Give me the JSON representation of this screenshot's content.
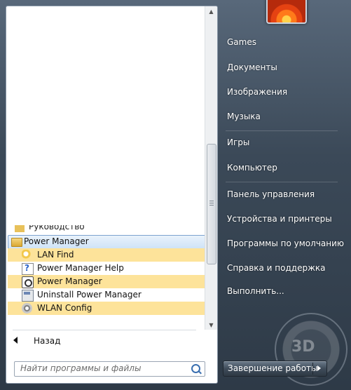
{
  "left": {
    "partial_item": "Руководство",
    "folder": "Power Manager",
    "entries": [
      {
        "label": "LAN Find",
        "icon": "lan-find-icon"
      },
      {
        "label": "Power Manager Help",
        "icon": "help-icon"
      },
      {
        "label": "Power Manager",
        "icon": "power-manager-icon"
      },
      {
        "label": "Uninstall Power Manager",
        "icon": "uninstall-icon"
      },
      {
        "label": "WLAN Config",
        "icon": "wlan-config-icon"
      }
    ],
    "back_label": "Назад",
    "search_placeholder": "Найти программы и файлы"
  },
  "right": {
    "items": [
      "Games",
      "Документы",
      "Изображения",
      "Музыка",
      "Игры",
      "Компьютер",
      "Панель управления",
      "Устройства и принтеры",
      "Программы по умолчанию",
      "Справка и поддержка",
      "Выполнить..."
    ],
    "shutdown_label": "Завершение работы"
  },
  "colors": {
    "highlight": "#fde39a",
    "folder_selected": "#cfe3f7"
  }
}
